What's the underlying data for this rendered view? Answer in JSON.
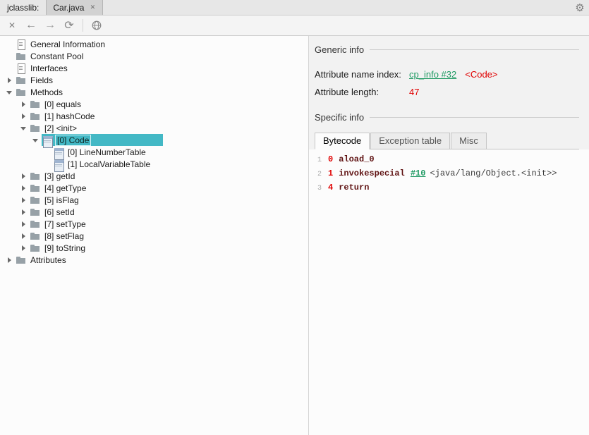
{
  "colors": {
    "selection": "#43b8c5",
    "link": "#1f9a63",
    "red": "#e00000"
  },
  "titlebar": {
    "app_label": "jclasslib:",
    "tab_label": "Car.java"
  },
  "tree": {
    "items": [
      {
        "label": "General Information"
      },
      {
        "label": "Constant Pool"
      },
      {
        "label": "Interfaces"
      },
      {
        "label": "Fields"
      },
      {
        "label": "Methods"
      },
      {
        "label": "[0] equals"
      },
      {
        "label": "[1] hashCode"
      },
      {
        "label": "[2] <init>"
      },
      {
        "label": "[0] Code"
      },
      {
        "label": "[0] LineNumberTable"
      },
      {
        "label": "[1] LocalVariableTable"
      },
      {
        "label": "[3] getId"
      },
      {
        "label": "[4] getType"
      },
      {
        "label": "[5] isFlag"
      },
      {
        "label": "[6] setId"
      },
      {
        "label": "[7] setType"
      },
      {
        "label": "[8] setFlag"
      },
      {
        "label": "[9] toString"
      },
      {
        "label": "Attributes"
      }
    ]
  },
  "detail": {
    "generic_title": "Generic info",
    "name_index_label": "Attribute name index:",
    "name_index_link": "cp_info #32",
    "name_index_type": "<Code>",
    "length_label": "Attribute length:",
    "length_value": "47",
    "specific_title": "Specific info",
    "tabs": {
      "bytecode": "Bytecode",
      "exception": "Exception table",
      "misc": "Misc"
    },
    "bytecode": {
      "lines": [
        {
          "num": "1",
          "offset": "0",
          "mnemonic": "aload_0"
        },
        {
          "num": "2",
          "offset": "1",
          "mnemonic": "invokespecial",
          "operand": "#10",
          "comment": "<java/lang/Object.<init>>"
        },
        {
          "num": "3",
          "offset": "4",
          "mnemonic": "return"
        }
      ]
    }
  }
}
